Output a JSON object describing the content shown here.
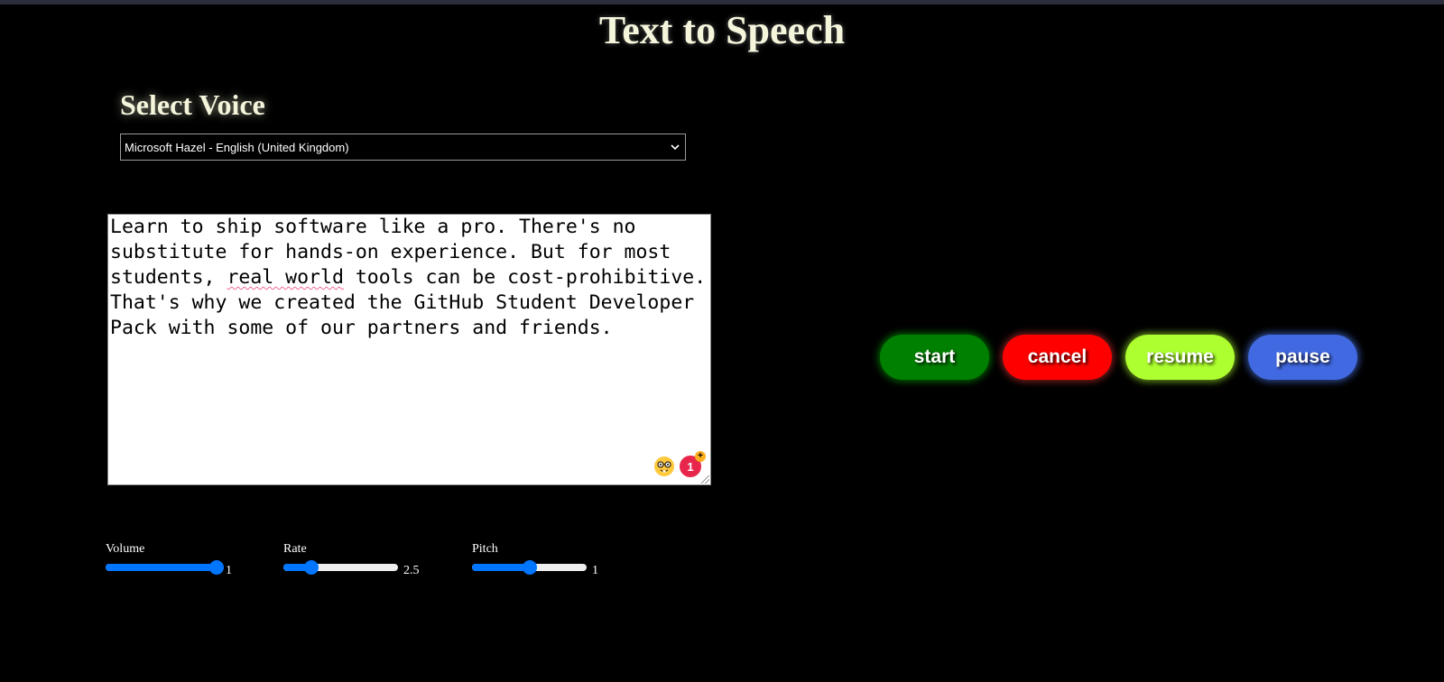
{
  "title": "Text to Speech",
  "voice": {
    "heading": "Select Voice",
    "selected": "Microsoft Hazel - English (United Kingdom)"
  },
  "text": {
    "before": "Learn to ship software like a pro. There's no substitute for hands-on experience. But for most students, ",
    "flagged": "real world",
    "after": " tools can be cost-prohibitive. That's why we created the GitHub Student Developer Pack with some of our partners and friends.",
    "badge_count": "1",
    "badge_plus": "+",
    "nerd_icon": "nerd-face-icon"
  },
  "buttons": {
    "start": "start",
    "cancel": "cancel",
    "resume": "resume",
    "pause": "pause"
  },
  "colors": {
    "start": "#008000",
    "cancel": "#ff0000",
    "resume": "#adff2f",
    "pause": "#4169e1"
  },
  "sliders": {
    "volume": {
      "label": "Volume",
      "value": "1",
      "min": 0,
      "max": 1,
      "level": 1
    },
    "rate": {
      "label": "Rate",
      "value": "2.5",
      "min": 0.1,
      "max": 10,
      "level": 2.5
    },
    "pitch": {
      "label": "Pitch",
      "value": "1",
      "min": 0,
      "max": 2,
      "level": 1
    }
  }
}
